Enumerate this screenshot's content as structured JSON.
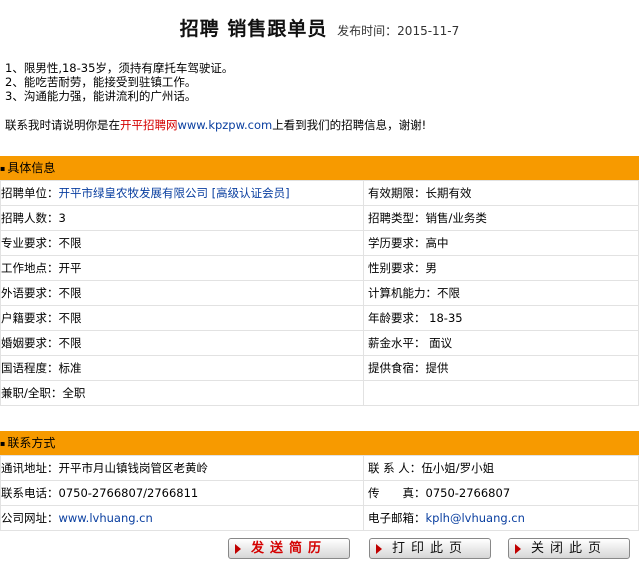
{
  "header": {
    "title": "招聘 销售跟单员",
    "date_label": "发布时间：2015-11-7"
  },
  "requirements": [
    "1、限男性,18-35岁，须持有摩托车驾驶证。",
    "2、能吃苦耐劳，能接受到驻镇工作。",
    "3、沟通能力强，能讲流利的广州话。"
  ],
  "contact_note": {
    "before": "联系我时请说明你是在",
    "site": "开平招聘网",
    "url": "www.kpzpw.com",
    "after": "上看到我们的招聘信息，谢谢!"
  },
  "detail_section": {
    "title": "具体信息",
    "rows": [
      {
        "left_label": "招聘单位：",
        "left_value": "开平市绿皇农牧发展有限公司 [高级认证会员]",
        "right_label": "有效期限：",
        "right_value": "长期有效"
      },
      {
        "left_label": "招聘人数：",
        "left_value": "3",
        "right_label": "招聘类型：",
        "right_value": "销售/业务类"
      },
      {
        "left_label": "专业要求：",
        "left_value": "不限",
        "right_label": "学历要求：",
        "right_value": "高中"
      },
      {
        "left_label": "工作地点：",
        "left_value": "开平",
        "right_label": "性别要求：",
        "right_value": "男"
      },
      {
        "left_label": "外语要求：",
        "left_value": "不限",
        "right_label": "计算机能力：",
        "right_value": "不限"
      },
      {
        "left_label": "户籍要求：",
        "left_value": "不限",
        "right_label": "年龄要求：",
        "right_value": " 18-35"
      },
      {
        "left_label": "婚姻要求：",
        "left_value": "不限",
        "right_label": "薪金水平：",
        "right_value": " 面议"
      },
      {
        "left_label": "国语程度：",
        "left_value": "标准",
        "right_label": "提供食宿：",
        "right_value": "提供"
      },
      {
        "left_label": "兼职/全职：",
        "left_value": "全职",
        "right_label": "",
        "right_value": ""
      }
    ]
  },
  "contact_section": {
    "title": "联系方式",
    "rows": [
      {
        "left_label": "通讯地址：",
        "left_value": "开平市月山镇钱岗管区老黄岭",
        "right_label": "联 系 人：",
        "right_value": "伍小姐/罗小姐"
      },
      {
        "left_label": "联系电话：",
        "left_value": "0750-2766807/2766811",
        "right_label": "传　　真：",
        "right_value": "0750-2766807"
      },
      {
        "left_label": "公司网址：",
        "left_value": "www.lvhuang.cn",
        "right_label": "电子邮箱：",
        "right_value": "kplh@lvhuang.cn"
      }
    ]
  },
  "buttons": {
    "send": "发送简历",
    "print": "打印此页",
    "close": "关闭此页"
  },
  "colors": {
    "section_header": "#f79a00",
    "accent_red": "#d40000",
    "link_blue": "#0a3fa0"
  }
}
